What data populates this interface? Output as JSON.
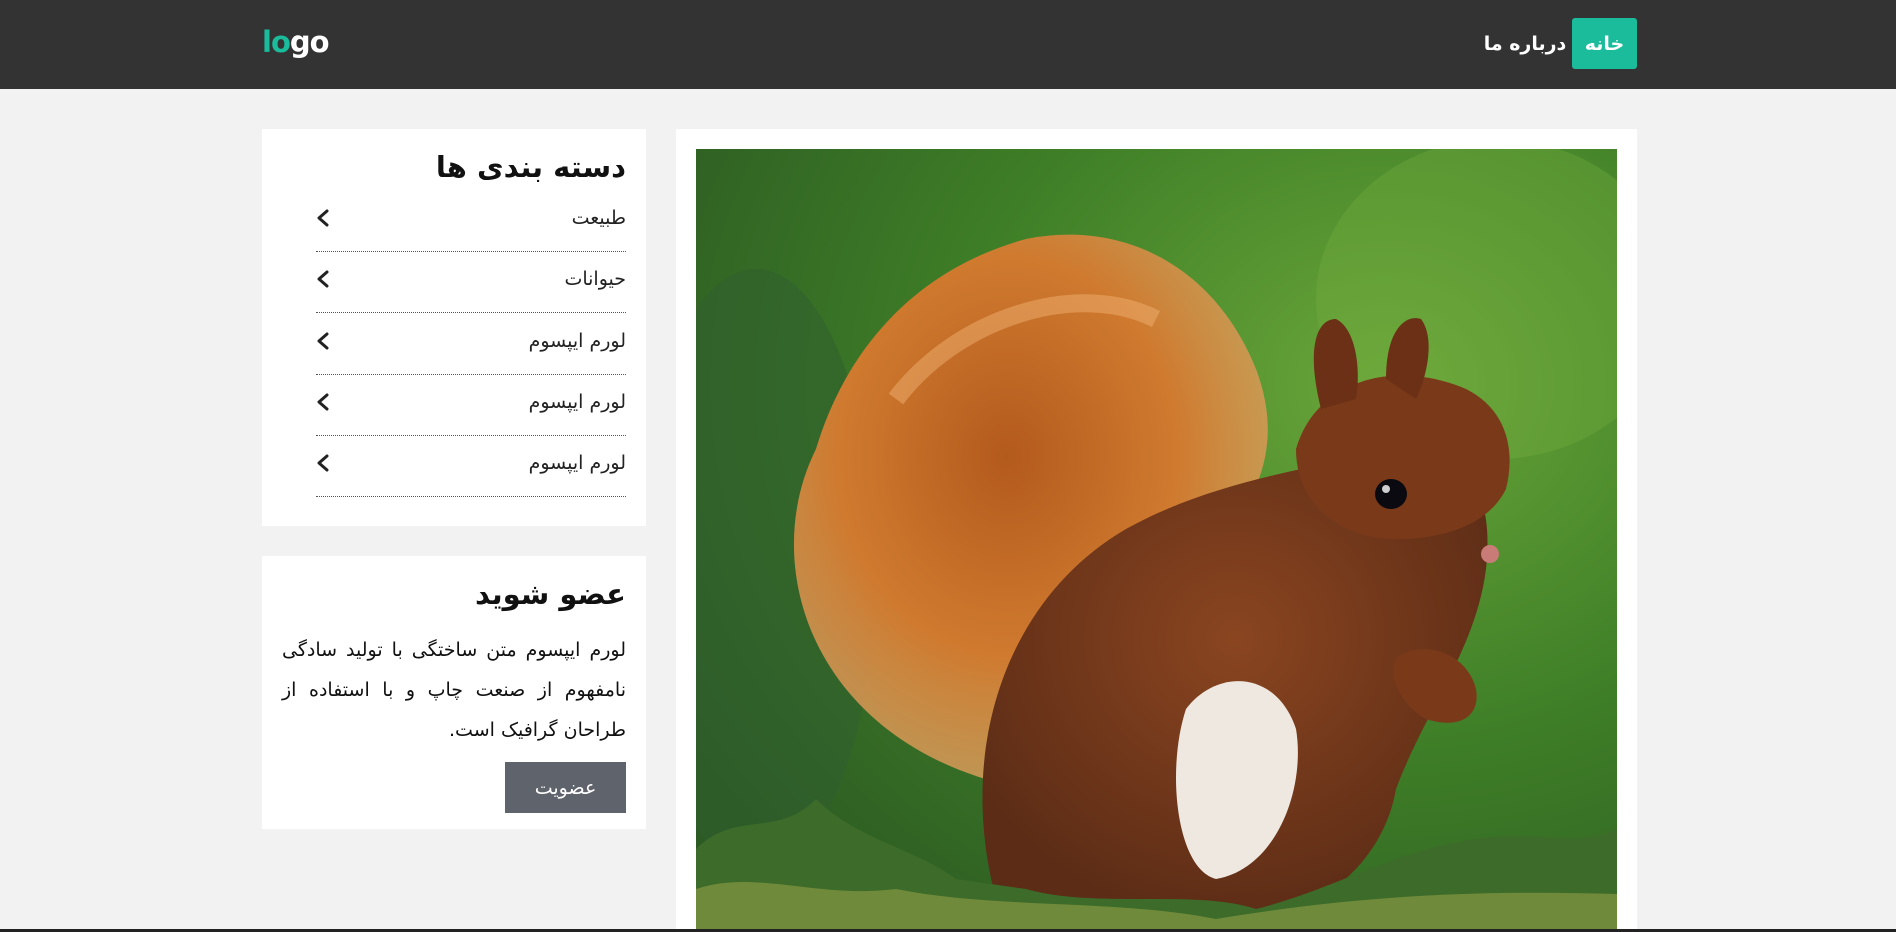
{
  "header": {
    "logo_part1": "lo",
    "logo_part2": "go",
    "nav": [
      {
        "label": "خانه",
        "active": true
      },
      {
        "label": "درباره ما",
        "active": false
      }
    ]
  },
  "colors": {
    "accent": "#1abc9c",
    "topbar": "#333333",
    "button": "#5f636b",
    "background": "#f2f2f2"
  },
  "categories": {
    "title": "دسته بندی ها",
    "items": [
      {
        "label": "طبیعت",
        "icon": "chevron-left-icon"
      },
      {
        "label": "حیوانات",
        "icon": "chevron-left-icon"
      },
      {
        "label": "لورم ایپسوم",
        "icon": "chevron-left-icon"
      },
      {
        "label": "لورم ایپسوم",
        "icon": "chevron-left-icon"
      },
      {
        "label": "لورم ایپسوم",
        "icon": "chevron-left-icon"
      }
    ]
  },
  "join": {
    "title": "عضو شوید",
    "text": "لورم ایپسوم متن ساختگی با تولید سادگی نامفهوم از صنعت چاپ و با استفاده از طراحان گرافیک است.",
    "button_label": "عضویت"
  },
  "main": {
    "image_subject": "red squirrel on grass"
  }
}
